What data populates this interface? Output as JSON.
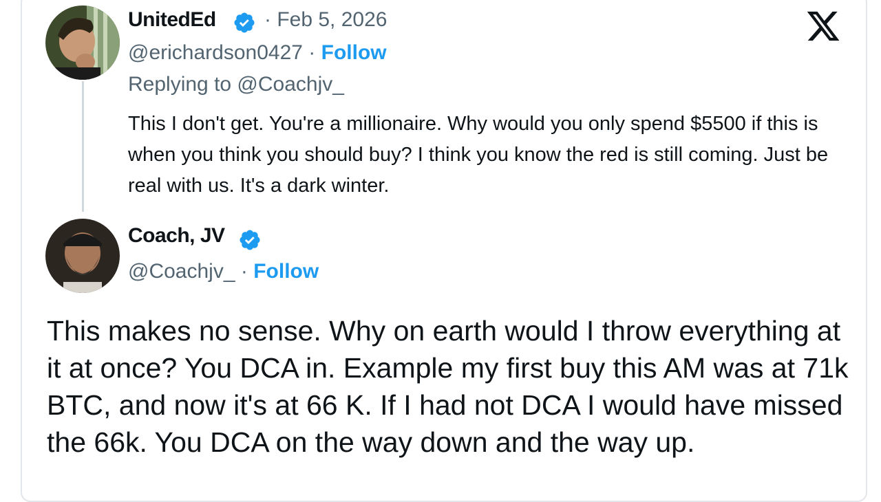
{
  "reply": {
    "display_name": "UnitedEd",
    "date": "· Feb 5, 2026",
    "handle": "@erichardson0427",
    "separator": " · ",
    "follow_label": "Follow",
    "replying_to": "Replying to @Coachjv_",
    "text": "This I don't get. You're a millionaire. Why would you only spend $5500 if this is when you think you should buy? I think you know the red is still coming. Just be real with us. It's a dark winter."
  },
  "main_post": {
    "display_name": "Coach, JV",
    "handle": "@Coachjv_",
    "separator": " · ",
    "follow_label": "Follow",
    "text": "This makes no sense. Why on earth would I throw everything at it at once? You DCA in. Example my first buy this AM was at 71k BTC, and now it's at 66 K. If I had not DCA I would have missed the 66k. You DCA on the way down and the way up."
  },
  "colors": {
    "accent": "#1d9bf0",
    "text": "#0f1419",
    "muted": "#536471"
  },
  "icons": [
    "x-logo-icon",
    "verified-badge-icon",
    "avatar"
  ]
}
